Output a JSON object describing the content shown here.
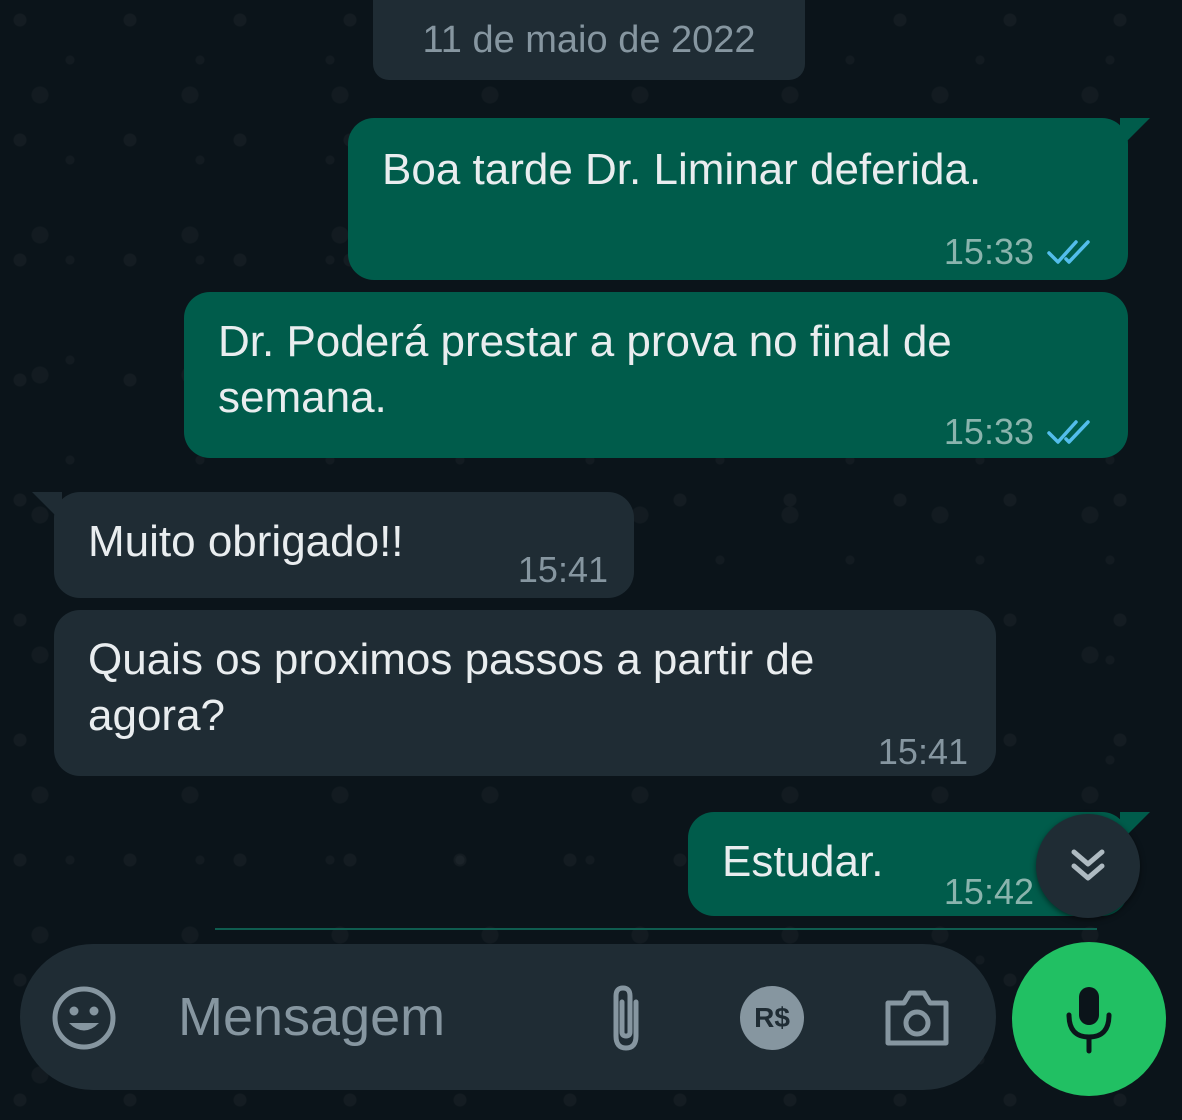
{
  "date_separator": "11 de maio de 2022",
  "messages": [
    {
      "direction": "outgoing",
      "text": "Boa tarde Dr. Liminar deferida.",
      "time": "15:33",
      "status": "read"
    },
    {
      "direction": "outgoing",
      "text": "Dr. Poderá prestar a prova no final de\nsemana.",
      "time": "15:33",
      "status": "read"
    },
    {
      "direction": "incoming",
      "text": "Muito obrigado!!",
      "time": "15:41"
    },
    {
      "direction": "incoming",
      "text": "Quais os proximos passos a partir de\nagora?",
      "time": "15:41"
    },
    {
      "direction": "outgoing",
      "text": "Estudar.",
      "time": "15:42"
    }
  ],
  "composer": {
    "placeholder": "Mensagem",
    "payment_icon_label": "R$"
  },
  "icons": {
    "emoji": "emoji-icon",
    "attach": "paperclip-icon",
    "payment": "payment-icon",
    "camera": "camera-icon",
    "mic": "microphone-icon",
    "scroll_down": "double-chevron-down-icon",
    "read_receipt": "double-check-icon"
  },
  "colors": {
    "background": "#0b141a",
    "outgoing_bubble": "#005c4b",
    "incoming_bubble": "#1f2c34",
    "read_tick": "#53bdeb",
    "accent_green": "#21c063"
  }
}
